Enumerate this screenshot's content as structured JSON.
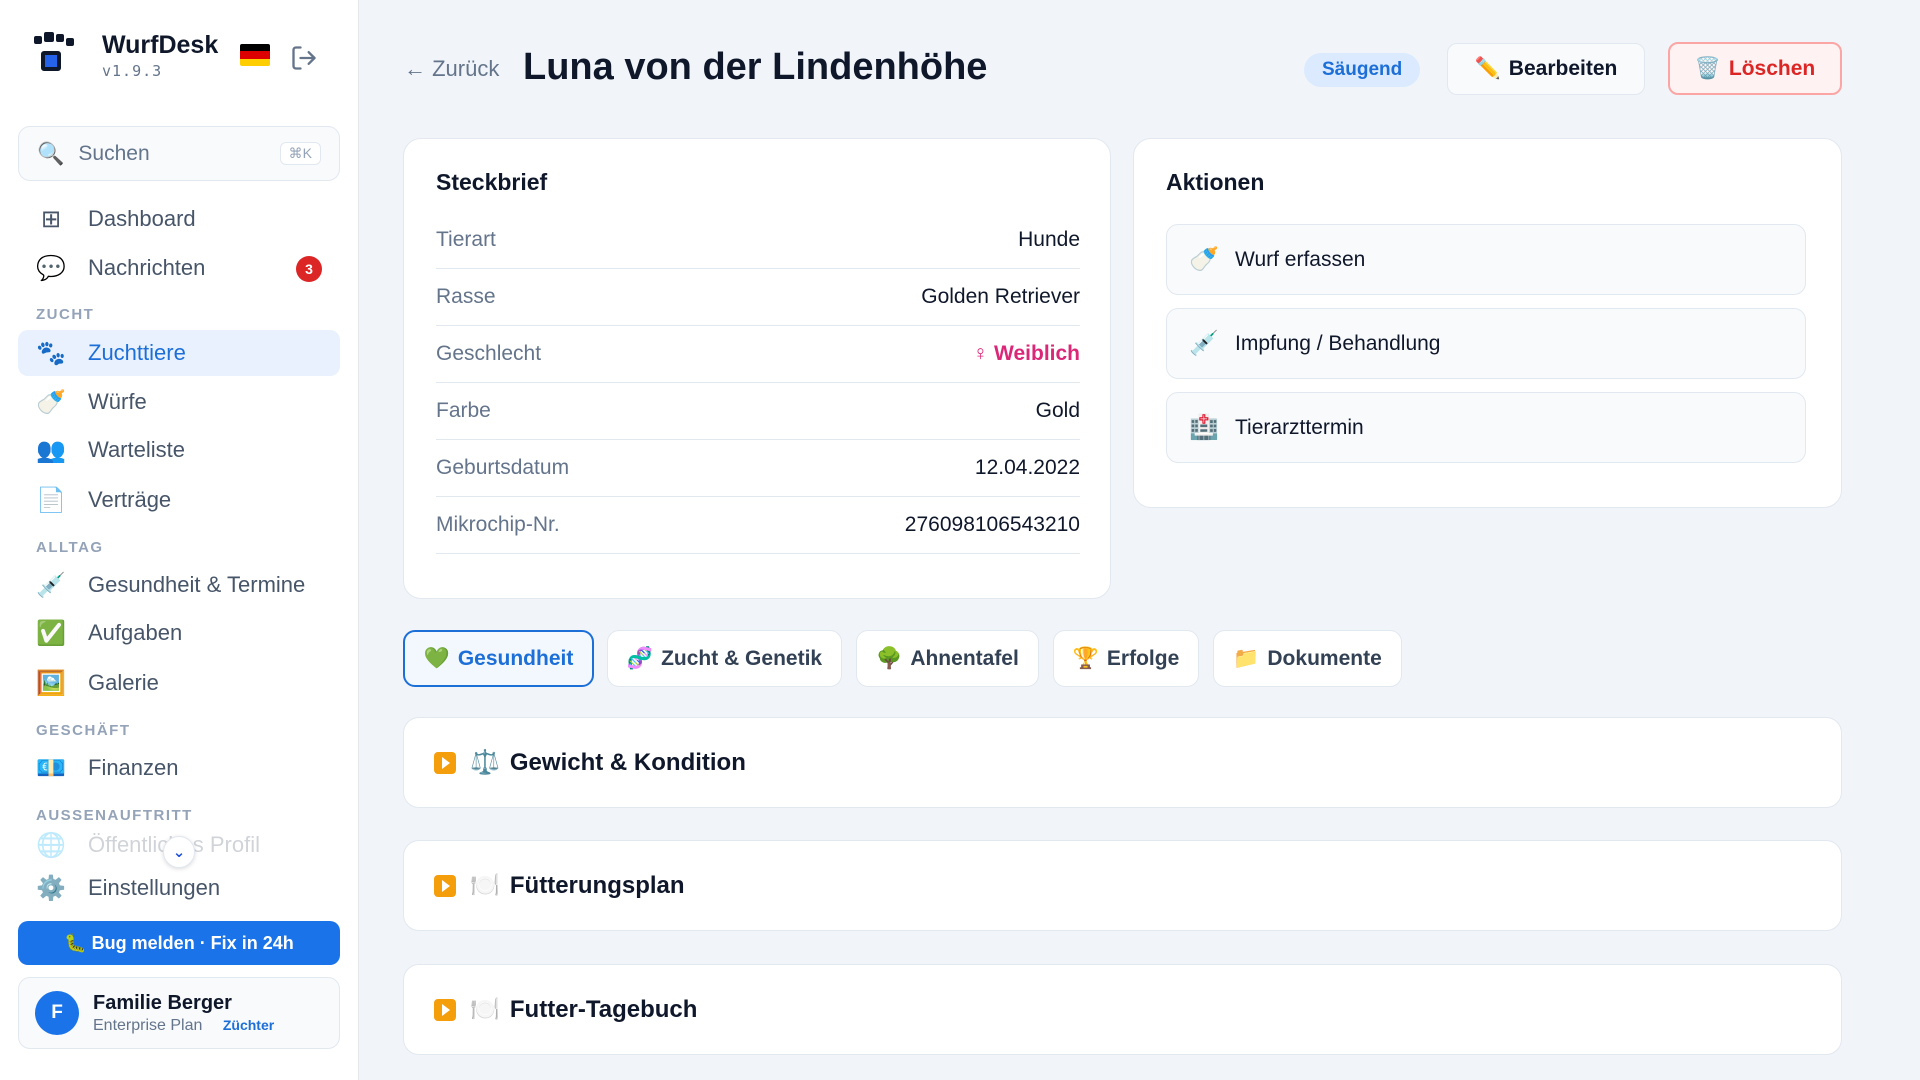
{
  "app": {
    "name": "WurfDesk",
    "version": "v1.9.3"
  },
  "sidebar": {
    "search": {
      "placeholder": "Suchen",
      "shortcut": "⌘K"
    },
    "items": [
      {
        "label": "Dashboard",
        "icon": "dashboard-icon"
      },
      {
        "label": "Nachrichten",
        "icon": "chat-bubble-icon",
        "badge": "3"
      },
      {
        "label": "Zuchttiere",
        "icon": "paw-icon",
        "active": true
      },
      {
        "label": "Würfe",
        "icon": "baby-bottle-icon"
      },
      {
        "label": "Warteliste",
        "icon": "people-icon"
      },
      {
        "label": "Verträge",
        "icon": "document-icon"
      },
      {
        "label": "Gesundheit & Termine",
        "icon": "syringe-icon"
      },
      {
        "label": "Aufgaben",
        "icon": "checkbox-icon"
      },
      {
        "label": "Galerie",
        "icon": "picture-icon"
      },
      {
        "label": "Finanzen",
        "icon": "banknote-icon"
      },
      {
        "label": "Öffentliches Profil",
        "icon": "globe-icon"
      },
      {
        "label": "Einstellungen",
        "icon": "gear-icon"
      }
    ],
    "sections": [
      "ZUCHT",
      "ALLTAG",
      "GESCHÄFT",
      "AUSSENAUFTRITT"
    ],
    "bug_button": "🐛 Bug melden · Fix in 24h",
    "user": {
      "initial": "F",
      "name": "Familie Berger",
      "plan": "Enterprise Plan",
      "role": "Züchter"
    }
  },
  "header": {
    "back": "← Zurück",
    "title": "Luna von der Lindenhöhe",
    "status": "Säugend",
    "edit": "Bearbeiten",
    "delete": "Löschen"
  },
  "profile": {
    "title": "Steckbrief",
    "rows": [
      {
        "label": "Tierart",
        "value": "Hunde"
      },
      {
        "label": "Rasse",
        "value": "Golden Retriever"
      },
      {
        "label": "Geschlecht",
        "value": "♀ Weiblich"
      },
      {
        "label": "Farbe",
        "value": "Gold"
      },
      {
        "label": "Geburtsdatum",
        "value": "12.04.2022"
      },
      {
        "label": "Mikrochip-Nr.",
        "value": "276098106543210"
      }
    ]
  },
  "actions": {
    "title": "Aktionen",
    "items": [
      {
        "label": "Wurf erfassen",
        "icon": "baby-bottle-icon"
      },
      {
        "label": "Impfung / Behandlung",
        "icon": "syringe-icon"
      },
      {
        "label": "Tierarzttermin",
        "icon": "hospital-icon"
      }
    ]
  },
  "tabs": [
    {
      "label": "Gesundheit",
      "icon": "green-heart-icon",
      "active": true
    },
    {
      "label": "Zucht & Genetik",
      "icon": "dna-icon"
    },
    {
      "label": "Ahnentafel",
      "icon": "tree-icon"
    },
    {
      "label": "Erfolge",
      "icon": "trophy-icon"
    },
    {
      "label": "Dokumente",
      "icon": "folder-icon"
    }
  ],
  "sections_main": [
    {
      "label": "Gewicht & Kondition",
      "icon": "scale-icon"
    },
    {
      "label": "Fütterungsplan",
      "icon": "plate-icon"
    },
    {
      "label": "Futter-Tagebuch",
      "icon": "plate-icon"
    }
  ],
  "colors": {
    "accent": "#1a73e8",
    "danger": "#dc2626",
    "female": "#db2777",
    "chevron": "#f59e0b"
  }
}
